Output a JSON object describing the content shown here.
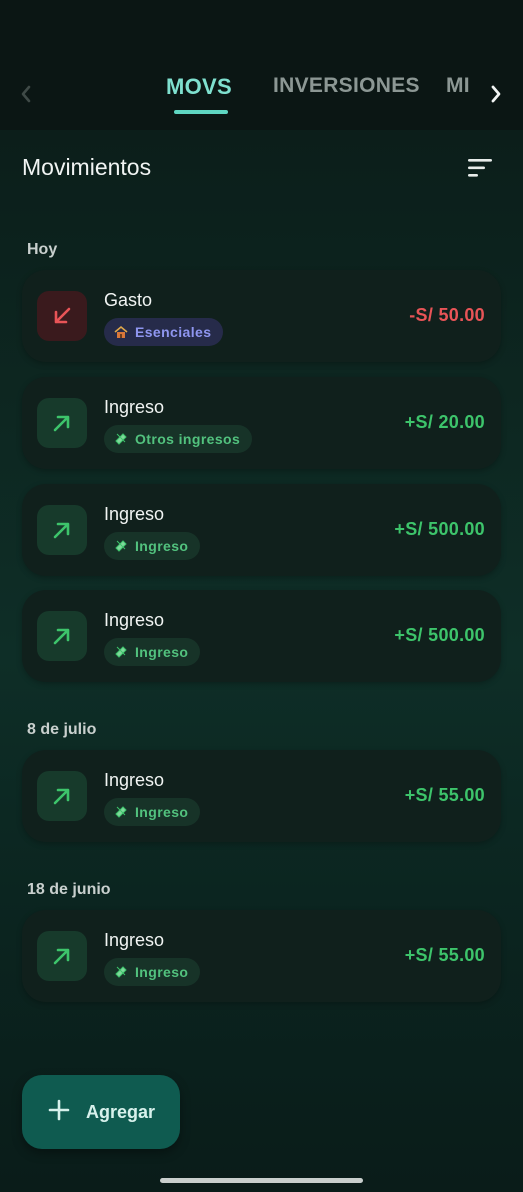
{
  "tabs": {
    "items": [
      "MOVS",
      "INVERSIONES",
      "MI"
    ],
    "active": "MOVS"
  },
  "header": {
    "title": "Movimientos"
  },
  "groups": [
    {
      "label": "Hoy",
      "items": [
        {
          "title": "Gasto",
          "category": "Esenciales",
          "amount": "-S/ 50.00",
          "kind": "expense"
        },
        {
          "title": "Ingreso",
          "category": "Otros ingresos",
          "amount": "+S/ 20.00",
          "kind": "income"
        },
        {
          "title": "Ingreso",
          "category": "Ingreso",
          "amount": "+S/ 500.00",
          "kind": "income"
        },
        {
          "title": "Ingreso",
          "category": "Ingreso",
          "amount": "+S/ 500.00",
          "kind": "income"
        }
      ]
    },
    {
      "label": "8 de julio",
      "items": [
        {
          "title": "Ingreso",
          "category": "Ingreso",
          "amount": "+S/ 55.00",
          "kind": "income"
        }
      ]
    },
    {
      "label": "18 de junio",
      "items": [
        {
          "title": "Ingreso",
          "category": "Ingreso",
          "amount": "+S/ 55.00",
          "kind": "income"
        }
      ]
    }
  ],
  "fab": {
    "label": "Agregar"
  },
  "colors": {
    "accent": "#5fd6c2",
    "income": "#3dc46b",
    "expense": "#e85457",
    "fab": "#0f5b50"
  },
  "icons": {
    "nav_left": "chevron-left-icon",
    "nav_right": "chevron-right-icon",
    "filter": "sort-filter-icon",
    "expense": "arrow-down-left-icon",
    "income": "arrow-up-right-icon",
    "expense_category": "house-icon",
    "income_category": "money-icon",
    "fab": "plus-icon"
  }
}
